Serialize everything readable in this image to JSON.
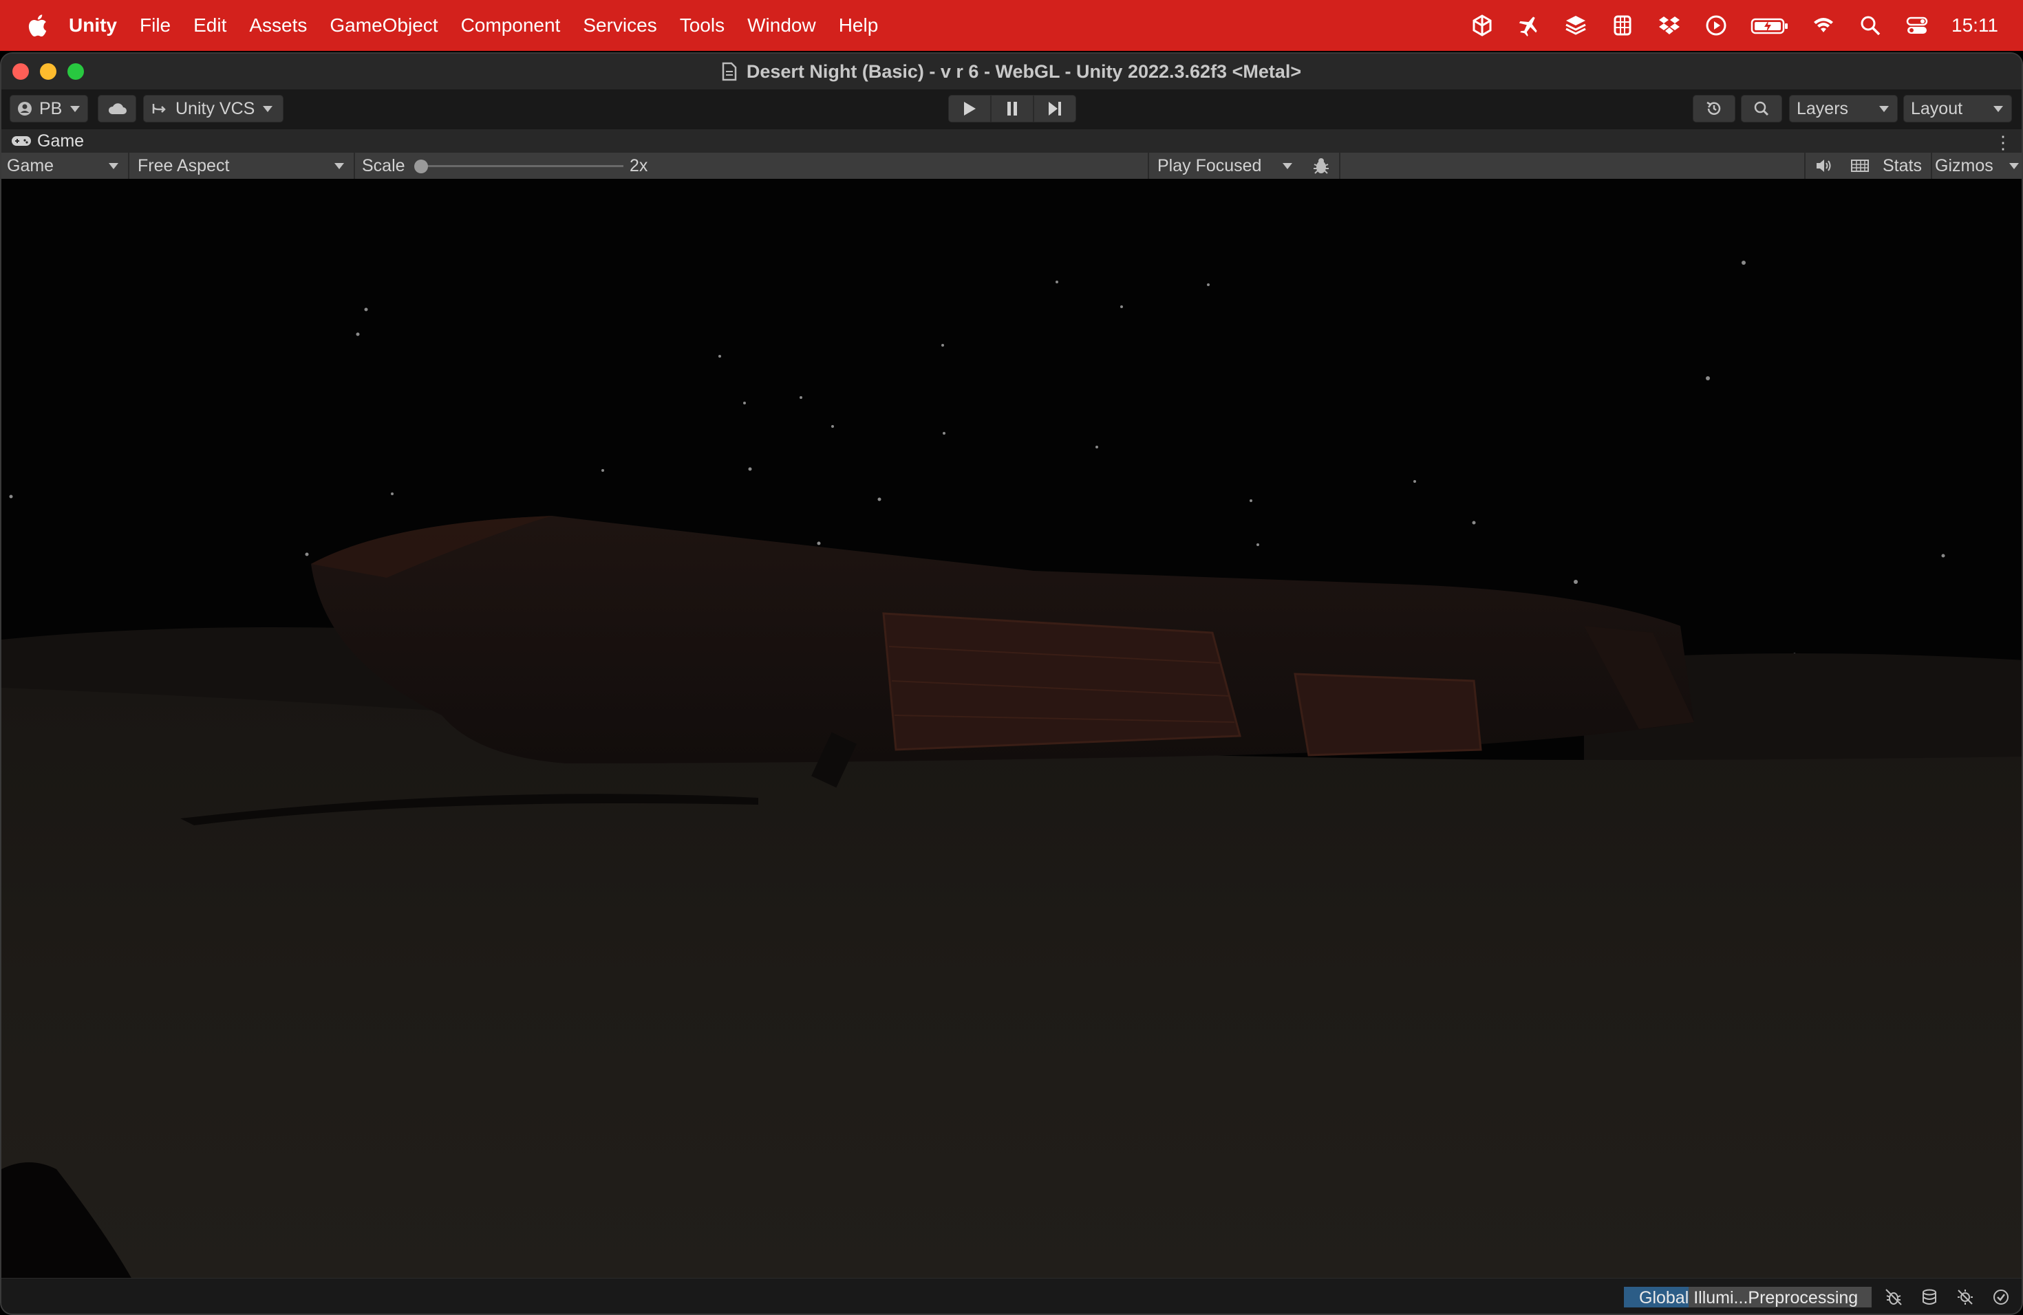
{
  "menubar": {
    "app": "Unity",
    "items": [
      "File",
      "Edit",
      "Assets",
      "GameObject",
      "Component",
      "Services",
      "Tools",
      "Window",
      "Help"
    ],
    "clock": "15:11",
    "status_icons": [
      "unity-hub-icon",
      "airplane-icon",
      "stack-icon",
      "puzzle-grid-icon",
      "dropbox-icon",
      "play-circle-icon",
      "battery-icon",
      "wifi-icon",
      "search-icon",
      "control-center-icon"
    ]
  },
  "window": {
    "title": "Desert Night (Basic) - v r 6 - WebGL - Unity 2022.3.62f3 <Metal>"
  },
  "toolbar": {
    "account": "PB",
    "vcs": "Unity VCS",
    "layers": "Layers",
    "layout": "Layout"
  },
  "game_tab": {
    "label": "Game"
  },
  "game_toolbar": {
    "display": "Game",
    "aspect": "Free Aspect",
    "scale_label": "Scale",
    "scale_value": "2x",
    "play_mode": "Play Focused",
    "stats": "Stats",
    "gizmos": "Gizmos"
  },
  "statusbar": {
    "progress_label": "Global Illumi...",
    "progress_stage": "Preprocessing",
    "progress_fraction": 0.26
  },
  "colors": {
    "menubar": "#d3211c",
    "editor_bg": "#191919",
    "toolbar_bg": "#3c3c3c",
    "progress_fill": "#2c5d87"
  }
}
